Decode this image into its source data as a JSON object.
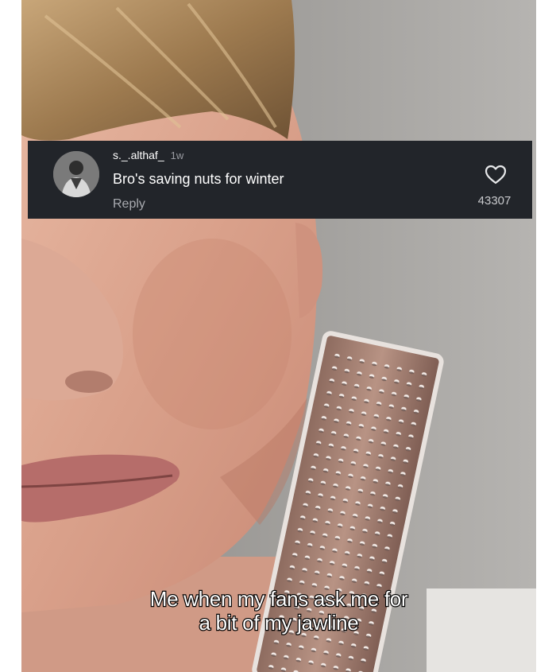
{
  "comment": {
    "username": "s._.althaf_",
    "timestamp": "1w",
    "text": "Bro's saving nuts for winter",
    "reply_label": "Reply",
    "like_count": "43307",
    "icons": {
      "avatar": "user-avatar",
      "like": "heart-outline-icon"
    }
  },
  "caption": {
    "line1": "Me when my fans ask me for",
    "line2": "a bit of my jawline"
  },
  "colors": {
    "comment_background": "#22252a",
    "comment_text": "#ffffff",
    "secondary_text": "#a9abb0",
    "caption_fill": "#ffffff",
    "caption_stroke": "#000000"
  }
}
